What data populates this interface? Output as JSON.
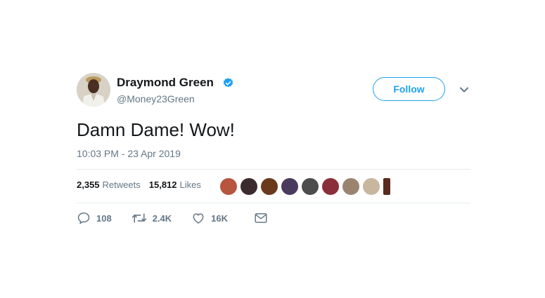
{
  "user": {
    "name": "Draymond Green",
    "handle": "@Money23Green",
    "verified": true
  },
  "follow_label": "Follow",
  "tweet": {
    "text": "Damn Dame! Wow!",
    "timestamp": "10:03 PM - 23 Apr 2019"
  },
  "stats": {
    "retweets_count": "2,355",
    "retweets_label": "Retweets",
    "likes_count": "15,812",
    "likes_label": "Likes"
  },
  "actions": {
    "replies": "108",
    "retweets": "2.4K",
    "likes": "16K"
  },
  "icons": {
    "verified": "verified-badge-icon",
    "caret": "chevron-down-icon",
    "reply": "reply-icon",
    "retweet": "retweet-icon",
    "like": "heart-icon",
    "message": "envelope-icon"
  },
  "colors": {
    "accent": "#1da1f2",
    "text": "#14171a",
    "muted": "#657786",
    "divider": "#e6ecf0"
  },
  "liker_colors": [
    "#b8553f",
    "#3b2a2e",
    "#6a3a1e",
    "#4a3b5e",
    "#4d4d4d",
    "#8a2f3a",
    "#9a8470",
    "#c8b79e",
    "#5a2a1e"
  ]
}
